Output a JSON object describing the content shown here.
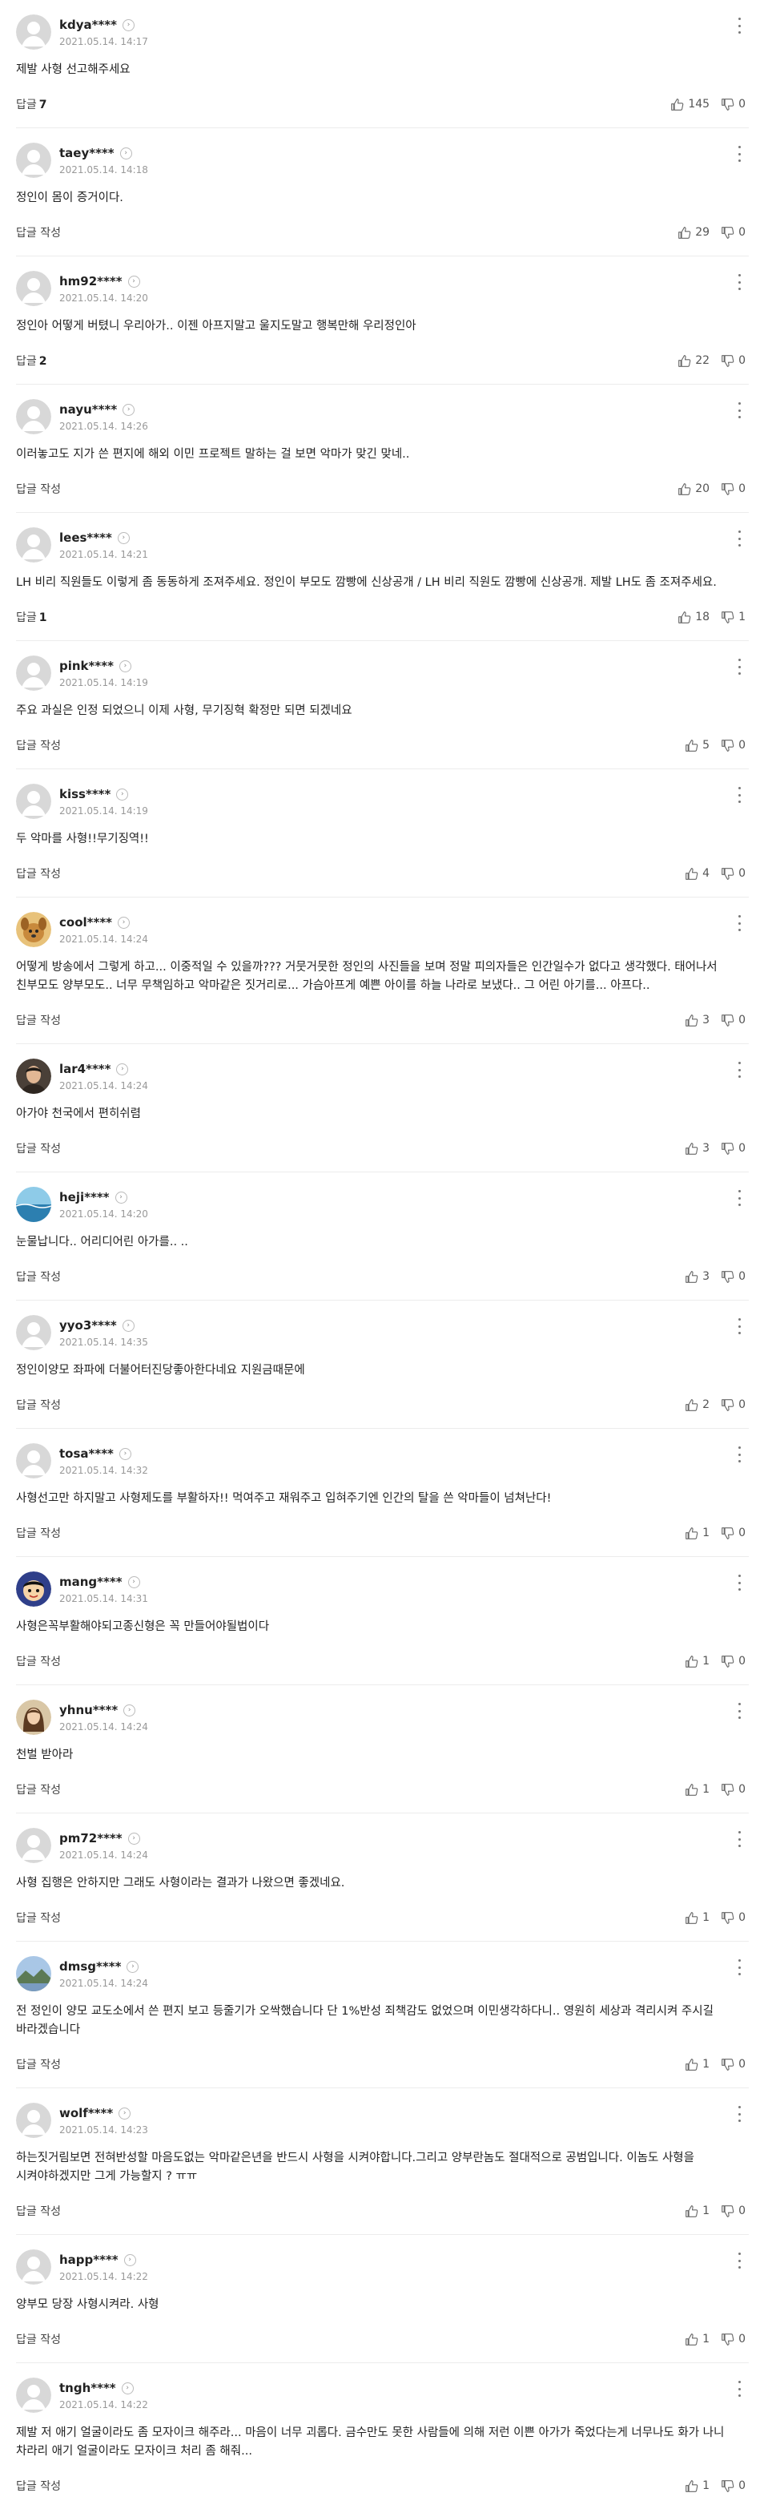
{
  "ui": {
    "reply_label": "답글",
    "reply_write_label": "답글 작성"
  },
  "comments": [
    {
      "user": "kdya****",
      "time": "2021.05.14. 14:17",
      "text": "제발 사형 선고해주세요",
      "reply": "7",
      "like": "145",
      "dislike": "0",
      "avatar": "default"
    },
    {
      "user": "taey****",
      "time": "2021.05.14. 14:18",
      "text": "정인이 몸이 증거이다.",
      "reply": "",
      "like": "29",
      "dislike": "0",
      "avatar": "default"
    },
    {
      "user": "hm92****",
      "time": "2021.05.14. 14:20",
      "text": "정인아 어떻게 버텼니 우리아가.. 이젠 아프지말고 울지도말고 행복만해 우리정인아",
      "reply": "2",
      "like": "22",
      "dislike": "0",
      "avatar": "default"
    },
    {
      "user": "nayu****",
      "time": "2021.05.14. 14:26",
      "text": "이러놓고도 지가 쓴 편지에 해외 이민 프로젝트 말하는 걸 보면 악마가 맞긴 맞네..",
      "reply": "",
      "like": "20",
      "dislike": "0",
      "avatar": "default"
    },
    {
      "user": "lees****",
      "time": "2021.05.14. 14:21",
      "text": "LH 비리 직원들도 이렇게 좀 동동하게 조져주세요. 정인이 부모도 깜빵에 신상공개 / LH 비리 직원도 깜빵에 신상공개. 제발 LH도 좀 조져주세요.",
      "reply": "1",
      "like": "18",
      "dislike": "1",
      "avatar": "default"
    },
    {
      "user": "pink****",
      "time": "2021.05.14. 14:19",
      "text": "주요 과실은 인정 되었으니 이제 사형, 무기징혁 확정만 되면 되겠네요",
      "reply": "",
      "like": "5",
      "dislike": "0",
      "avatar": "default"
    },
    {
      "user": "kiss****",
      "time": "2021.05.14. 14:19",
      "text": "두 악마를 사형!!무기징역!!",
      "reply": "",
      "like": "4",
      "dislike": "0",
      "avatar": "default"
    },
    {
      "user": "cool****",
      "time": "2021.05.14. 14:24",
      "text": "어떻게 방송에서 그렇게 하고... 이중적일 수 있을까??? 거뭇거뭇한 정인의 사진들을 보며 정말 피의자들은 인간일수가 없다고 생각했다. 태어나서 친부모도 양부모도.. 너무 무책임하고 악마같은 짓거리로... 가슴아프게 예쁜 아이를 하늘 나라로 보냈다.. 그 어린 아기를... 아프다..",
      "reply": "",
      "like": "3",
      "dislike": "0",
      "avatar": "dog"
    },
    {
      "user": "lar4****",
      "time": "2021.05.14. 14:24",
      "text": "아가야 천국에서 편히쉬렴",
      "reply": "",
      "like": "3",
      "dislike": "0",
      "avatar": "person"
    },
    {
      "user": "heji****",
      "time": "2021.05.14. 14:20",
      "text": "눈물납니다.. 어리디어린 아가를.. ..",
      "reply": "",
      "like": "3",
      "dislike": "0",
      "avatar": "sea"
    },
    {
      "user": "yyo3****",
      "time": "2021.05.14. 14:35",
      "text": "정인이양모 좌파에 더불어터진당좋아한다네요 지원금때문에",
      "reply": "",
      "like": "2",
      "dislike": "0",
      "avatar": "default"
    },
    {
      "user": "tosa****",
      "time": "2021.05.14. 14:32",
      "text": "사형선고만 하지말고 사형제도를 부활하자!! 먹여주고 재워주고 입혀주기엔 인간의 탈을 쓴 악마들이 넘쳐난다!",
      "reply": "",
      "like": "1",
      "dislike": "0",
      "avatar": "default"
    },
    {
      "user": "mang****",
      "time": "2021.05.14. 14:31",
      "text": "사형은꼭부활해야되고종신형은 꼭 만들어야될법이다",
      "reply": "",
      "like": "1",
      "dislike": "0",
      "avatar": "cartoon"
    },
    {
      "user": "yhnu****",
      "time": "2021.05.14. 14:24",
      "text": "천벌 받아라",
      "reply": "",
      "like": "1",
      "dislike": "0",
      "avatar": "woman"
    },
    {
      "user": "pm72****",
      "time": "2021.05.14. 14:24",
      "text": "사형 집행은 안하지만 그래도 사형이라는 결과가 나왔으면 좋겠네요.",
      "reply": "",
      "like": "1",
      "dislike": "0",
      "avatar": "default"
    },
    {
      "user": "dmsg****",
      "time": "2021.05.14. 14:24",
      "text": "전 정인이 양모 교도소에서 쓴 편지 보고 등줄기가 오싹했습니다 단 1%반성 죄책감도 없었으며 이민생각하다니.. 영원히 세상과 격리시켜 주시길 바라겠습니다",
      "reply": "",
      "like": "1",
      "dislike": "0",
      "avatar": "landscape"
    },
    {
      "user": "wolf****",
      "time": "2021.05.14. 14:23",
      "text": "하는짓거림보면 전혀반성할 마음도없는 악마같은년을 반드시 사형을 시켜야합니다.그리고 양부란놈도 절대적으로 공범입니다. 이놈도 사형을 시켜야하겠지만 그게 가능할지 ? ㅠㅠ",
      "reply": "",
      "like": "1",
      "dislike": "0",
      "avatar": "default"
    },
    {
      "user": "happ****",
      "time": "2021.05.14. 14:22",
      "text": "양부모 당장 사형시켜라. 사형",
      "reply": "",
      "like": "1",
      "dislike": "0",
      "avatar": "default"
    },
    {
      "user": "tngh****",
      "time": "2021.05.14. 14:22",
      "text": "제발 저 애기 얼굴이라도 좀 모자이크 해주라... 마음이 너무 괴롭다. 금수만도 못한 사람들에 의해 저런 이쁜 아가가 죽었다는게 너무나도 화가 나니 차라리 애기 얼굴이라도 모자이크 처리 좀 해줘...",
      "reply": "",
      "like": "1",
      "dislike": "0",
      "avatar": "default"
    }
  ]
}
